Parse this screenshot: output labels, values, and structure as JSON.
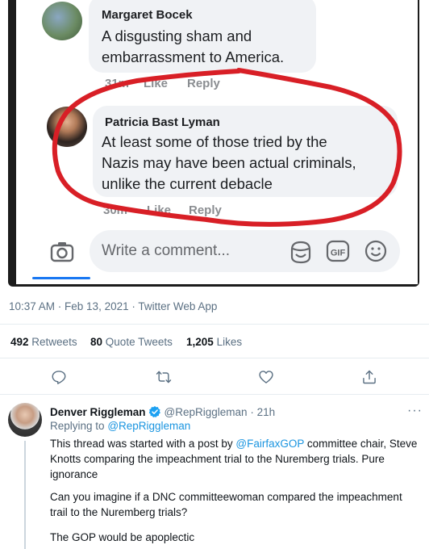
{
  "embed": {
    "comments": [
      {
        "name": "Margaret Bocek",
        "text_line1": "A disgusting sham and",
        "text_line2": "embarrassment to America.",
        "time": "31m",
        "like": "Like",
        "reply": "Reply"
      },
      {
        "name": "Patricia Bast Lyman",
        "text_line1": "At least some of those tried by the",
        "text_line2": "Nazis may have been actual criminals,",
        "text_line3": "unlike the current debacle",
        "time": "30m",
        "like": "Like",
        "reply": "Reply"
      }
    ],
    "composer_placeholder": "Write a comment...",
    "gif_label": "GIF",
    "annotation_color": "#d81f26"
  },
  "tweet": {
    "timestamp": "10:37 AM · Feb 13, 2021 · Twitter Web App",
    "retweets_count": "492",
    "retweets_label": "Retweets",
    "quotes_count": "80",
    "quotes_label": "Quote Tweets",
    "likes_count": "1,205",
    "likes_label": "Likes",
    "actions": [
      "reply-icon",
      "retweet-icon",
      "like-icon",
      "share-icon"
    ]
  },
  "reply": {
    "name": "Denver Riggleman",
    "handle": "@RepRiggleman",
    "time": "· 21h",
    "replying_prefix": "Replying to",
    "replying_handle": "@RepRiggleman",
    "p1_a": "This thread was started with a post by",
    "p1_mention": "@FairfaxGOP",
    "p1_b": "committee chair, Steve",
    "p1_line2": "Knotts comparing the impeachment trial to the Nuremberg trials. Pure",
    "p1_line3": "ignorance",
    "p2_line1": "Can you imagine if a DNC committeewoman compared the impeachment",
    "p2_line2": "trail to the Nuremberg trials?",
    "p3_line1": "The GOP would be apoplectic",
    "more": "···"
  },
  "colors": {
    "link": "#1b95e0",
    "muted": "#5b7083",
    "verified": "#1da1f2"
  }
}
